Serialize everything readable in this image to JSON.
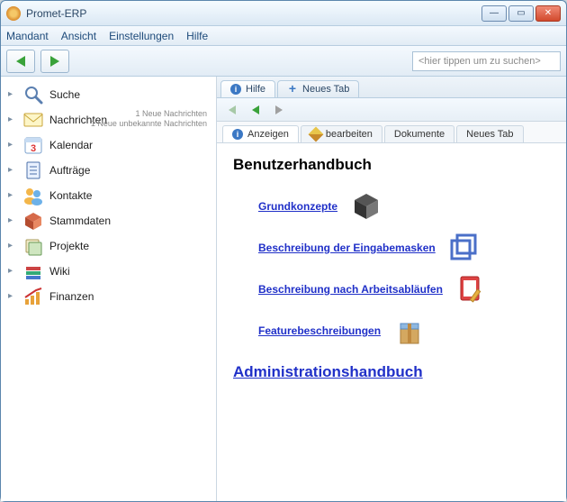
{
  "window": {
    "title": "Promet-ERP"
  },
  "menu": {
    "items": [
      "Mandant",
      "Ansicht",
      "Einstellungen",
      "Hilfe"
    ]
  },
  "toolbar": {
    "search_placeholder": "<hier tippen um zu suchen>"
  },
  "sidebar": {
    "items": [
      {
        "label": "Suche",
        "icon": "search"
      },
      {
        "label": "Nachrichten",
        "icon": "mail",
        "sub1": "1 Neue Nachrichten",
        "sub2": "1 Neue unbekannte Nachrichten"
      },
      {
        "label": "Kalendar",
        "icon": "calendar"
      },
      {
        "label": "Aufträge",
        "icon": "orders"
      },
      {
        "label": "Kontakte",
        "icon": "contacts"
      },
      {
        "label": "Stammdaten",
        "icon": "masterdata"
      },
      {
        "label": "Projekte",
        "icon": "projects"
      },
      {
        "label": "Wiki",
        "icon": "wiki"
      },
      {
        "label": "Finanzen",
        "icon": "finance"
      }
    ]
  },
  "outer_tabs": [
    {
      "label": "Hilfe",
      "icon": "info",
      "active": true
    },
    {
      "label": "Neues Tab",
      "icon": "plus",
      "active": false
    }
  ],
  "inner_tabs": [
    {
      "label": "Anzeigen",
      "icon": "info",
      "active": true
    },
    {
      "label": "bearbeiten",
      "icon": "pencil",
      "active": false
    },
    {
      "label": "Dokumente",
      "active": false
    },
    {
      "label": "Neues Tab",
      "active": false
    }
  ],
  "content": {
    "heading": "Benutzerhandbuch",
    "links": [
      {
        "label": "Grundkonzepte",
        "icon": "cube"
      },
      {
        "label": "Beschreibung der Eingabemasken",
        "icon": "windows"
      },
      {
        "label": "Beschreibung nach Arbeitsabläufen",
        "icon": "edit-doc"
      },
      {
        "label": "Featurebeschreibungen",
        "icon": "package"
      }
    ],
    "admin_link": "Administrationshandbuch"
  }
}
